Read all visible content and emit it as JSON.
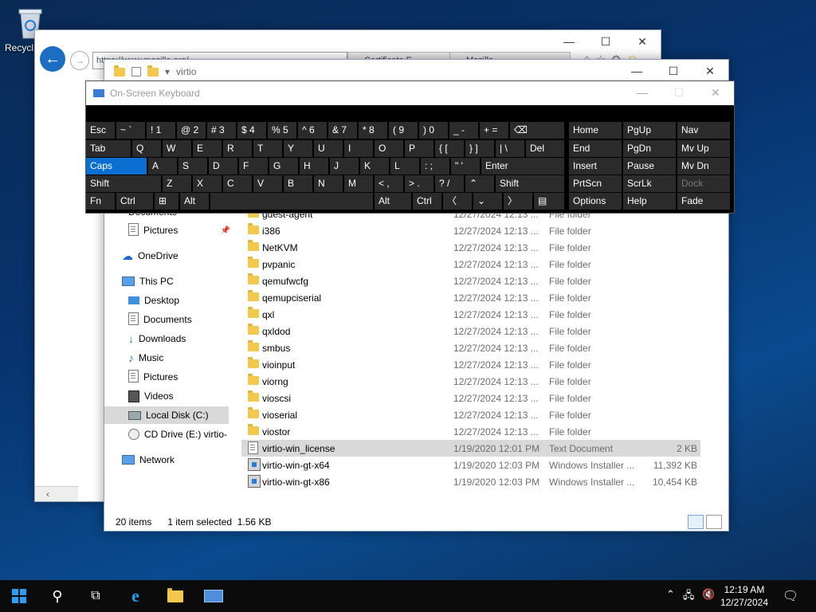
{
  "desktop": {
    "recycle_label": "Recycl"
  },
  "ie": {
    "address": "https://www.mozilla.org/",
    "tab1": "Certificate E...",
    "tab2": "Mozilla..."
  },
  "explorer": {
    "path": "virtio",
    "nav": {
      "documents": "Documents",
      "pictures": "Pictures",
      "onedrive": "OneDrive",
      "thispc": "This PC",
      "desktop": "Desktop",
      "documents2": "Documents",
      "downloads": "Downloads",
      "music": "Music",
      "pictures2": "Pictures",
      "videos": "Videos",
      "localdisk": "Local Disk (C:)",
      "cddrive": "CD Drive (E:) virtio-",
      "network": "Network"
    },
    "files": [
      {
        "name": "guest-agent",
        "date": "12/27/2024 12:13 ...",
        "type": "File folder",
        "size": "",
        "kind": "folder"
      },
      {
        "name": "i386",
        "date": "12/27/2024 12:13 ...",
        "type": "File folder",
        "size": "",
        "kind": "folder"
      },
      {
        "name": "NetKVM",
        "date": "12/27/2024 12:13 ...",
        "type": "File folder",
        "size": "",
        "kind": "folder"
      },
      {
        "name": "pvpanic",
        "date": "12/27/2024 12:13 ...",
        "type": "File folder",
        "size": "",
        "kind": "folder"
      },
      {
        "name": "qemufwcfg",
        "date": "12/27/2024 12:13 ...",
        "type": "File folder",
        "size": "",
        "kind": "folder"
      },
      {
        "name": "qemupciserial",
        "date": "12/27/2024 12:13 ...",
        "type": "File folder",
        "size": "",
        "kind": "folder"
      },
      {
        "name": "qxl",
        "date": "12/27/2024 12:13 ...",
        "type": "File folder",
        "size": "",
        "kind": "folder"
      },
      {
        "name": "qxldod",
        "date": "12/27/2024 12:13 ...",
        "type": "File folder",
        "size": "",
        "kind": "folder"
      },
      {
        "name": "smbus",
        "date": "12/27/2024 12:13 ...",
        "type": "File folder",
        "size": "",
        "kind": "folder"
      },
      {
        "name": "vioinput",
        "date": "12/27/2024 12:13 ...",
        "type": "File folder",
        "size": "",
        "kind": "folder"
      },
      {
        "name": "viorng",
        "date": "12/27/2024 12:13 ...",
        "type": "File folder",
        "size": "",
        "kind": "folder"
      },
      {
        "name": "vioscsi",
        "date": "12/27/2024 12:13 ...",
        "type": "File folder",
        "size": "",
        "kind": "folder"
      },
      {
        "name": "vioserial",
        "date": "12/27/2024 12:13 ...",
        "type": "File folder",
        "size": "",
        "kind": "folder"
      },
      {
        "name": "viostor",
        "date": "12/27/2024 12:13 ...",
        "type": "File folder",
        "size": "",
        "kind": "folder"
      },
      {
        "name": "virtio-win_license",
        "date": "1/19/2020 12:01 PM",
        "type": "Text Document",
        "size": "2 KB",
        "kind": "doc"
      },
      {
        "name": "virtio-win-gt-x64",
        "date": "1/19/2020 12:03 PM",
        "type": "Windows Installer ...",
        "size": "11,392 KB",
        "kind": "msi"
      },
      {
        "name": "virtio-win-gt-x86",
        "date": "1/19/2020 12:03 PM",
        "type": "Windows Installer ...",
        "size": "10,454 KB",
        "kind": "msi"
      }
    ],
    "status": {
      "items": "20 items",
      "selected": "1 item selected",
      "size": "1.56 KB"
    }
  },
  "osk": {
    "title": "On-Screen Keyboard",
    "keys": {
      "esc": "Esc",
      "tilde": "~  `",
      "k1": "!  1",
      "k2": "@  2",
      "k3": "#  3",
      "k4": "$  4",
      "k5": "%  5",
      "k6": "^  6",
      "k7": "&  7",
      "k8": "*  8",
      "k9": "(  9",
      "k0": ")  0",
      "minus": "_  -",
      "plus": "+  =",
      "bksp": "⌫",
      "tab": "Tab",
      "q": "Q",
      "w": "W",
      "e": "E",
      "r": "R",
      "t": "T",
      "y": "Y",
      "u": "U",
      "i": "I",
      "o": "O",
      "p": "P",
      "lbr": "{  [",
      "rbr": "}  ]",
      "pipe": "|  \\",
      "del": "Del",
      "caps": "Caps",
      "a": "A",
      "s": "S",
      "d": "D",
      "f": "F",
      "g": "G",
      "h": "H",
      "j": "J",
      "k": "K",
      "l": "L",
      "semi": ":  ;",
      "quote": "\"  '",
      "enter": "Enter",
      "lshift": "Shift",
      "z": "Z",
      "x": "X",
      "c": "C",
      "v": "V",
      "b": "B",
      "n": "N",
      "m": "M",
      "comma": "<  ,",
      "period": ">  .",
      "slash": "?  /",
      "up": "⌃",
      "rshift": "Shift",
      "fn": "Fn",
      "lctrl": "Ctrl",
      "win": "⊞",
      "lalt": "Alt",
      "ralt": "Alt",
      "rctrl": "Ctrl",
      "left": "〈",
      "down": "⌄",
      "right": "〉",
      "menu": "▤",
      "home": "Home",
      "pgup": "PgUp",
      "nav": "Nav",
      "end": "End",
      "pgdn": "PgDn",
      "mvup": "Mv Up",
      "insert": "Insert",
      "pause": "Pause",
      "mvdn": "Mv Dn",
      "prtscn": "PrtScn",
      "scrlk": "ScrLk",
      "dock": "Dock",
      "options": "Options",
      "help": "Help",
      "fade": "Fade"
    }
  },
  "taskbar": {
    "time": "12:19 AM",
    "date": "12/27/2024"
  }
}
